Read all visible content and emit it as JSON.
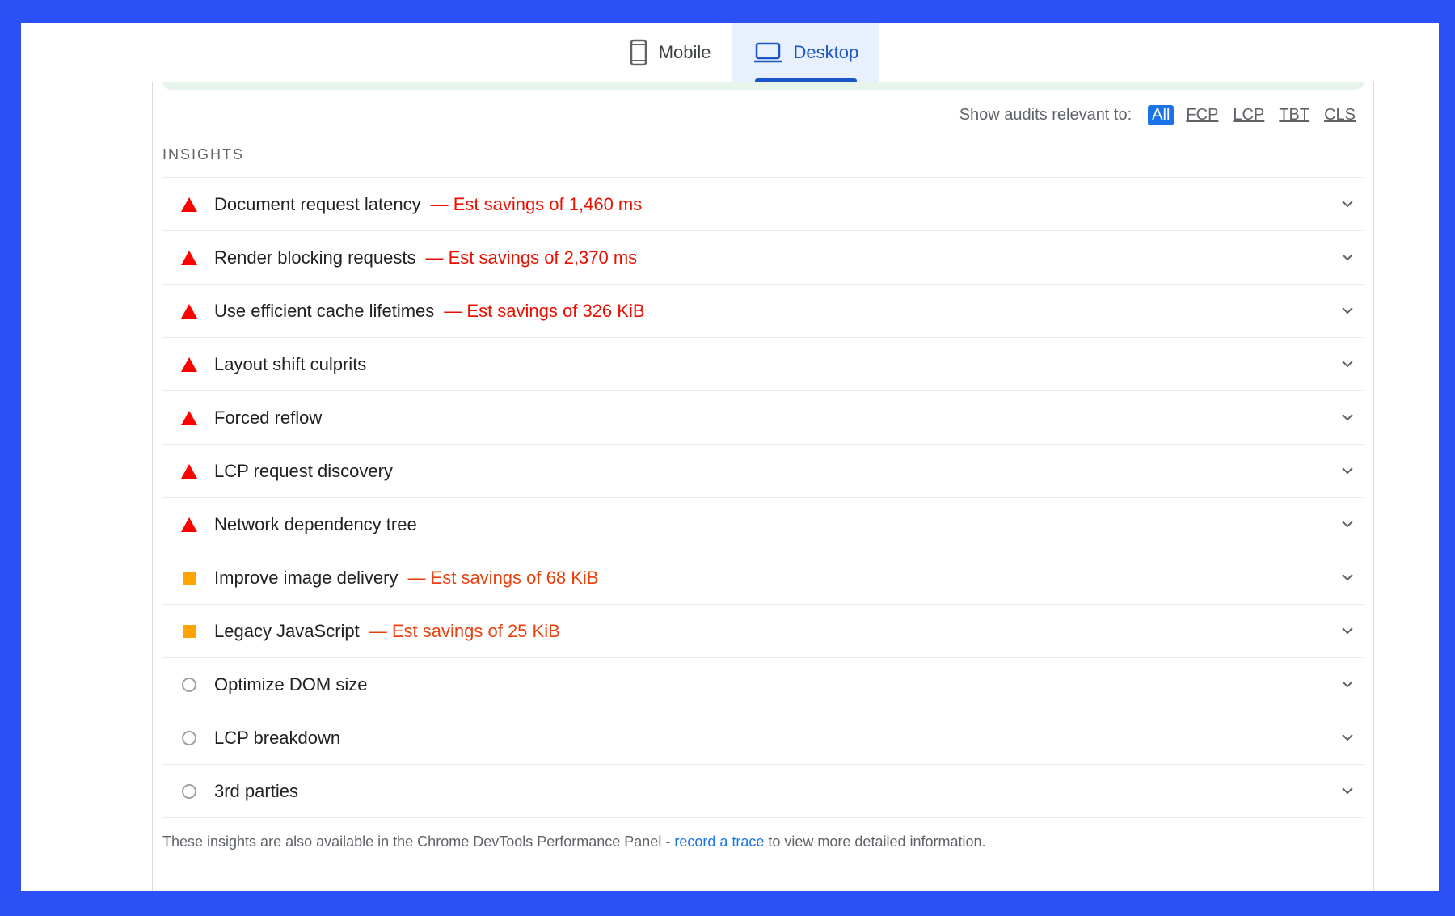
{
  "tabs": [
    {
      "label": "Mobile",
      "icon": "phone-icon",
      "active": false
    },
    {
      "label": "Desktop",
      "icon": "laptop-icon",
      "active": true
    }
  ],
  "filter": {
    "label": "Show audits relevant to:",
    "options": [
      "All",
      "FCP",
      "LCP",
      "TBT",
      "CLS"
    ],
    "selected": "All"
  },
  "section_title": "INSIGHTS",
  "audits": [
    {
      "title": "Document request latency",
      "savings": "— Est savings of 1,460 ms",
      "status": "fail"
    },
    {
      "title": "Render blocking requests",
      "savings": "— Est savings of 2,370 ms",
      "status": "fail"
    },
    {
      "title": "Use efficient cache lifetimes",
      "savings": "— Est savings of 326 KiB",
      "status": "fail"
    },
    {
      "title": "Layout shift culprits",
      "savings": "",
      "status": "fail"
    },
    {
      "title": "Forced reflow",
      "savings": "",
      "status": "fail"
    },
    {
      "title": "LCP request discovery",
      "savings": "",
      "status": "fail"
    },
    {
      "title": "Network dependency tree",
      "savings": "",
      "status": "fail"
    },
    {
      "title": "Improve image delivery",
      "savings": "— Est savings of 68 KiB",
      "status": "average"
    },
    {
      "title": "Legacy JavaScript",
      "savings": "— Est savings of 25 KiB",
      "status": "average"
    },
    {
      "title": "Optimize DOM size",
      "savings": "",
      "status": "info"
    },
    {
      "title": "LCP breakdown",
      "savings": "",
      "status": "info"
    },
    {
      "title": "3rd parties",
      "savings": "",
      "status": "info"
    }
  ],
  "footnote": {
    "before": "These insights are also available in the Chrome DevTools Performance Panel - ",
    "link": "record a trace",
    "after": " to view more detailed information."
  },
  "colors": {
    "fail": "#ff0000",
    "average": "#ffa400",
    "info": "#9aa0a6",
    "accent": "#1a73e8",
    "frame": "#2b50f5"
  }
}
